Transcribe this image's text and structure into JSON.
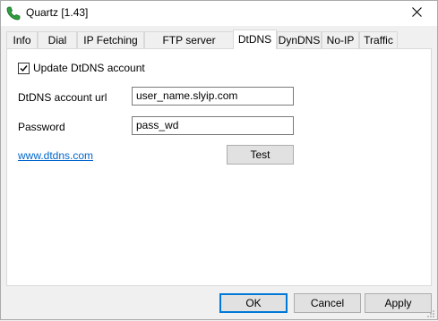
{
  "window": {
    "title": "Quartz [1.43]",
    "close_icon": "close-icon",
    "app_icon": "phone-handset-icon"
  },
  "tabs": [
    {
      "label": "Info"
    },
    {
      "label": "Dial"
    },
    {
      "label": "IP Fetching"
    },
    {
      "label": "FTP server update"
    },
    {
      "label": "DtDNS",
      "active": true
    },
    {
      "label": "DynDNS"
    },
    {
      "label": "No-IP"
    },
    {
      "label": "Traffic"
    }
  ],
  "panel": {
    "update_checkbox": {
      "label": "Update DtDNS account",
      "checked": true
    },
    "url_field": {
      "label": "DtDNS account url",
      "value": "user_name.slyip.com"
    },
    "password_field": {
      "label": "Password",
      "value": "pass_wd"
    },
    "link": "www.dtdns.com",
    "test_button": "Test"
  },
  "footer": {
    "ok": "OK",
    "cancel": "Cancel",
    "apply": "Apply"
  },
  "colors": {
    "link": "#0066cc",
    "default_button_border": "#0078d7",
    "icon_green": "#2e9e3e"
  }
}
